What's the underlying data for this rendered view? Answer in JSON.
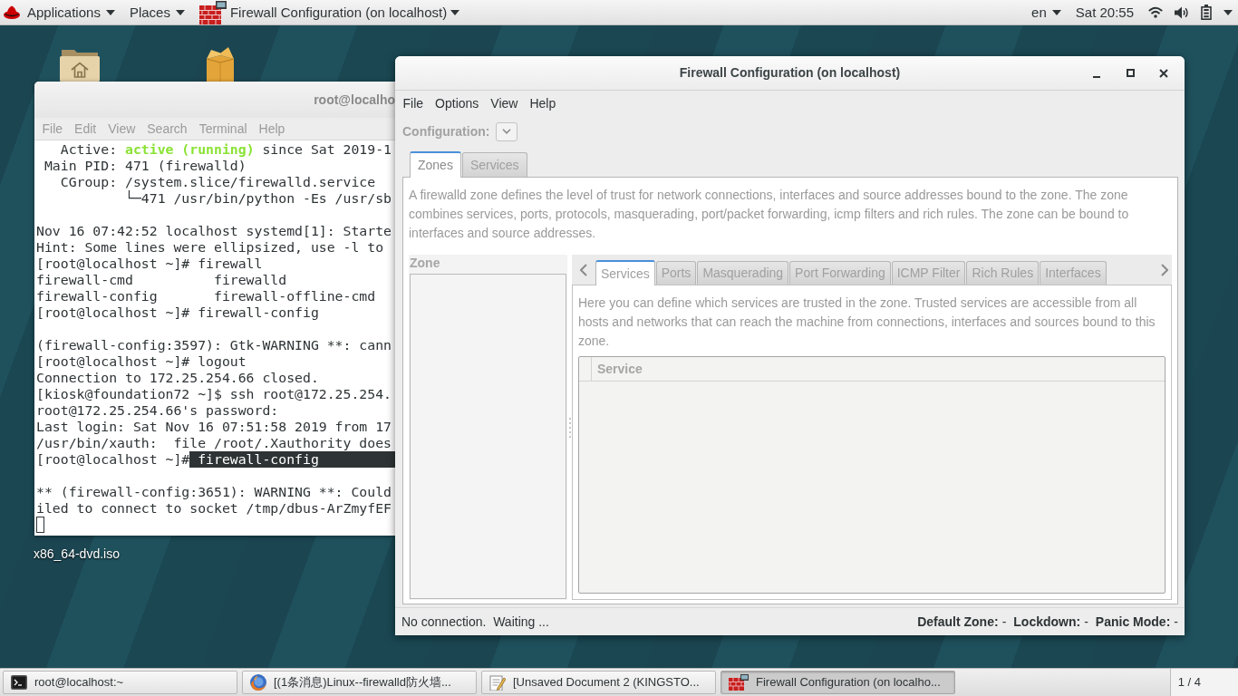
{
  "top_bar": {
    "menus": [
      {
        "label": "Applications"
      },
      {
        "label": "Places"
      }
    ],
    "app_menu": {
      "label": "Firewall Configuration (on localhost)"
    },
    "input_source": "en",
    "clock": "Sat 20:55"
  },
  "desktop": {
    "labels": [
      "x86_64-dvd.iso"
    ]
  },
  "terminal": {
    "title": "root@localho",
    "menu": [
      "File",
      "Edit",
      "View",
      "Search",
      "Terminal",
      "Help"
    ],
    "lines": [
      {
        "parts": [
          {
            "text": "   Active: "
          },
          {
            "text": "active (running)",
            "kind": "status"
          },
          {
            "text": " since Sat 2019-1"
          }
        ]
      },
      {
        "text": " Main PID: 471 (firewalld)"
      },
      {
        "text": "   CGroup: /system.slice/firewalld.service"
      },
      {
        "text": "           └─471 /usr/bin/python -Es /usr/sb"
      },
      {
        "text": "Nov 16 07:42:52 localhost systemd[1]: Starte",
        "blank_before": true
      },
      {
        "text": "Hint: Some lines were ellipsized, use -l to"
      },
      {
        "text": "[root@localhost ~]# firewall"
      },
      {
        "text": "firewall-cmd          firewalld"
      },
      {
        "text": "firewall-config       firewall-offline-cmd"
      },
      {
        "text": "[root@localhost ~]# firewall-config"
      },
      {
        "text": "(firewall-config:3597): Gtk-WARNING **: cann",
        "blank_before": true
      },
      {
        "text": "[root@localhost ~]# logout"
      },
      {
        "text": "Connection to 172.25.254.66 closed."
      },
      {
        "text": "[kiosk@foundation72 ~]$ ssh root@172.25.254."
      },
      {
        "text": "root@172.25.254.66's password:"
      },
      {
        "text": "Last login: Sat Nov 16 07:51:58 2019 from 17"
      },
      {
        "text": "/usr/bin/xauth:  file /root/.Xauthority does"
      },
      {
        "parts": [
          {
            "text": "[root@localhost ~]#"
          },
          {
            "text": " firewall-config",
            "kind": "selection"
          }
        ]
      },
      {
        "text": "** (firewall-config:3651): WARNING **: Could",
        "blank_before": true
      },
      {
        "text": "iled to connect to socket /tmp/dbus-ArZmyfEF"
      }
    ],
    "cursor": true
  },
  "firewall_window": {
    "title": "Firewall Configuration (on localhost)",
    "menu": [
      "File",
      "Options",
      "View",
      "Help"
    ],
    "configuration": {
      "label": "Configuration:",
      "disabled": true
    },
    "notebook": {
      "disabled": true,
      "tabs": [
        {
          "label": "Zones",
          "selected": true
        },
        {
          "label": "Services",
          "selected": false
        }
      ],
      "description": "A firewalld zone defines the level of trust for network connections, interfaces and source addresses bound to the zone. The zone combines services, ports, protocols, masquerading, port/packet forwarding, icmp filters and rich rules. The zone can be bound to interfaces and source addresses.",
      "zone_list": {
        "header": "Zone"
      },
      "zone_tabs": [
        {
          "label": "Services",
          "selected": true
        },
        {
          "label": "Ports",
          "selected": false
        },
        {
          "label": "Masquerading",
          "selected": false
        },
        {
          "label": "Port Forwarding",
          "selected": false
        },
        {
          "label": "ICMP Filter",
          "selected": false
        },
        {
          "label": "Rich Rules",
          "selected": false
        },
        {
          "label": "Interfaces",
          "selected": false
        }
      ],
      "zone_tab_description": "Here you can define which services are trusted in the zone. Trusted services are accessible from all hosts and networks that can reach the machine from connections, interfaces and sources bound to this zone.",
      "services_table": {
        "columns": [
          "Service"
        ]
      }
    },
    "status_bar": {
      "message": "No connection.  Waiting ...",
      "fields": [
        {
          "label": "Default Zone:",
          "value": "-"
        },
        {
          "label": "Lockdown:",
          "value": "-"
        },
        {
          "label": "Panic Mode:",
          "value": "-"
        }
      ]
    }
  },
  "taskbar": {
    "items": [
      {
        "label": "root@localhost:~",
        "kind": "terminal",
        "selected": false
      },
      {
        "label": "[(1条消息)Linux--firewalld防火墙...",
        "kind": "browser",
        "selected": false
      },
      {
        "label": "[Unsaved Document 2 (KINGSTO...",
        "kind": "editor",
        "selected": false
      },
      {
        "label": "Firewall Configuration (on localho...",
        "kind": "firewall",
        "selected": true
      }
    ],
    "workspace": "1 / 4"
  }
}
